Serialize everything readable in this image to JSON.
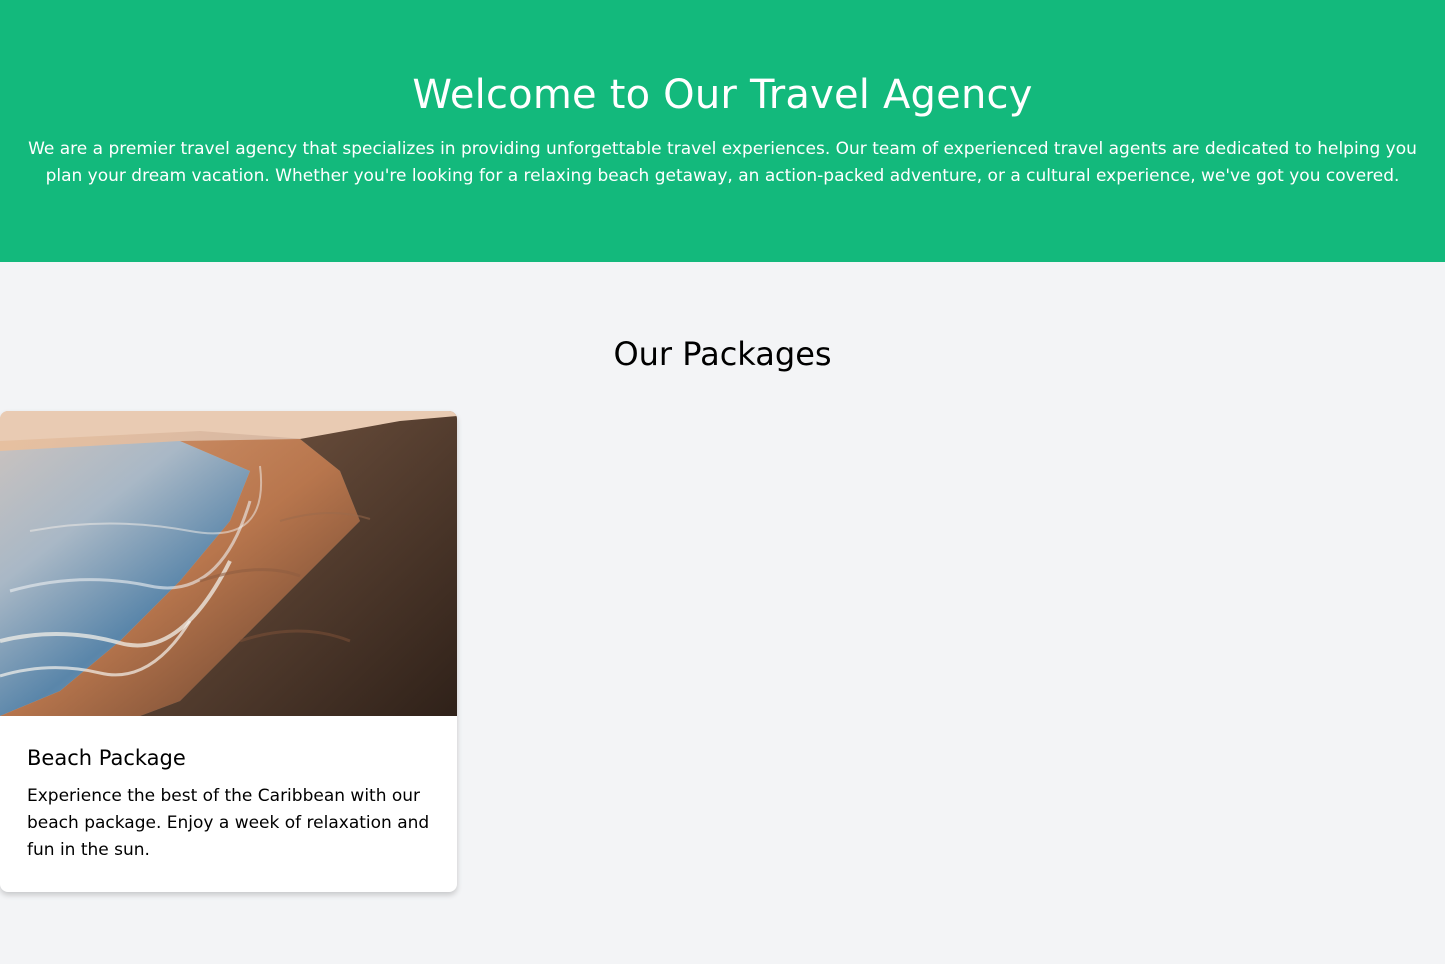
{
  "hero": {
    "title": "Welcome to Our Travel Agency",
    "description": "We are a premier travel agency that specializes in providing unforgettable travel experiences. Our team of experienced travel agents are dedicated to helping you plan your dream vacation. Whether you're looking for a relaxing beach getaway, an action-packed adventure, or a cultural experience, we've got you covered.",
    "background_color": "#13b97c",
    "text_color": "#ffffff"
  },
  "packages": {
    "heading": "Our Packages",
    "items": [
      {
        "image": "beach-photo",
        "title": "Beach Package",
        "description": "Experience the best of the Caribbean with our beach package. Enjoy a week of relaxation and fun in the sun."
      }
    ]
  },
  "colors": {
    "page_background": "#f3f4f6",
    "card_background": "#ffffff",
    "accent": "#13b97c"
  }
}
